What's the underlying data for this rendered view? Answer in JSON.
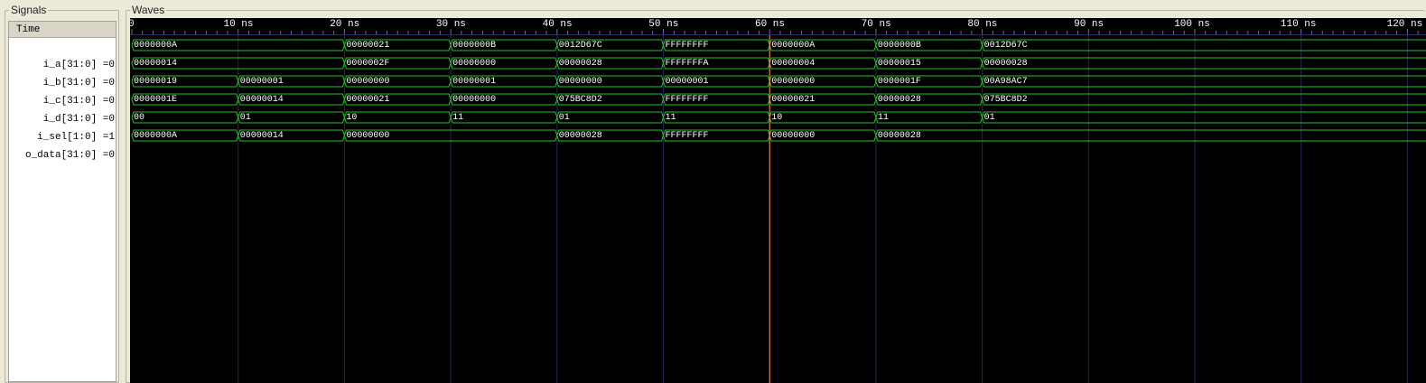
{
  "panels": {
    "signals_title": "Signals",
    "waves_title": "Waves"
  },
  "time_row_label": "Time",
  "signals": [
    {
      "name": "i_a[31:0] =0"
    },
    {
      "name": "i_b[31:0] =0"
    },
    {
      "name": "i_c[31:0] =0"
    },
    {
      "name": "i_d[31:0] =0"
    },
    {
      "name": "i_sel[1:0] =1"
    },
    {
      "name": "o_data[31:0] =0"
    }
  ],
  "timeline": {
    "unit": "ns",
    "major_ticks": [
      0,
      10,
      20,
      30,
      40,
      50,
      60,
      70,
      80,
      90,
      100,
      110,
      120
    ],
    "cursor_time": 60,
    "visible_end": 121
  },
  "waves": [
    {
      "signal": "i_a",
      "segments": [
        {
          "t": 0,
          "v": "0000000A"
        },
        {
          "t": 20,
          "v": "00000021"
        },
        {
          "t": 30,
          "v": "0000000B"
        },
        {
          "t": 40,
          "v": "0012D67C"
        },
        {
          "t": 50,
          "v": "FFFFFFFF"
        },
        {
          "t": 60,
          "v": "0000000A"
        },
        {
          "t": 70,
          "v": "0000000B"
        },
        {
          "t": 80,
          "v": "0012D67C"
        }
      ]
    },
    {
      "signal": "i_b",
      "segments": [
        {
          "t": 0,
          "v": "00000014"
        },
        {
          "t": 20,
          "v": "0000002F"
        },
        {
          "t": 30,
          "v": "00000000"
        },
        {
          "t": 40,
          "v": "00000028"
        },
        {
          "t": 50,
          "v": "FFFFFFFA"
        },
        {
          "t": 60,
          "v": "00000004"
        },
        {
          "t": 70,
          "v": "00000015"
        },
        {
          "t": 80,
          "v": "00000028"
        }
      ]
    },
    {
      "signal": "i_c",
      "segments": [
        {
          "t": 0,
          "v": "00000019"
        },
        {
          "t": 10,
          "v": "00000001"
        },
        {
          "t": 20,
          "v": "00000000"
        },
        {
          "t": 30,
          "v": "00000001"
        },
        {
          "t": 40,
          "v": "00000000"
        },
        {
          "t": 50,
          "v": "00000001"
        },
        {
          "t": 60,
          "v": "00000000"
        },
        {
          "t": 70,
          "v": "0000001F"
        },
        {
          "t": 80,
          "v": "00A98AC7"
        }
      ]
    },
    {
      "signal": "i_d",
      "segments": [
        {
          "t": 0,
          "v": "0000001E"
        },
        {
          "t": 10,
          "v": "00000014"
        },
        {
          "t": 20,
          "v": "00000021"
        },
        {
          "t": 30,
          "v": "00000000"
        },
        {
          "t": 40,
          "v": "075BC8D2"
        },
        {
          "t": 50,
          "v": "FFFFFFFF"
        },
        {
          "t": 60,
          "v": "00000021"
        },
        {
          "t": 70,
          "v": "00000028"
        },
        {
          "t": 80,
          "v": "075BC8D2"
        }
      ]
    },
    {
      "signal": "i_sel",
      "segments": [
        {
          "t": 0,
          "v": "00"
        },
        {
          "t": 10,
          "v": "01"
        },
        {
          "t": 20,
          "v": "10"
        },
        {
          "t": 30,
          "v": "11"
        },
        {
          "t": 40,
          "v": "01"
        },
        {
          "t": 50,
          "v": "11"
        },
        {
          "t": 60,
          "v": "10"
        },
        {
          "t": 70,
          "v": "11"
        },
        {
          "t": 80,
          "v": "01"
        }
      ]
    },
    {
      "signal": "o_data",
      "segments": [
        {
          "t": 0,
          "v": "0000000A"
        },
        {
          "t": 10,
          "v": "00000014"
        },
        {
          "t": 20,
          "v": "00000000"
        },
        {
          "t": 40,
          "v": "00000028"
        },
        {
          "t": 50,
          "v": "FFFFFFFF"
        },
        {
          "t": 60,
          "v": "00000000"
        },
        {
          "t": 70,
          "v": "00000028"
        }
      ]
    }
  ],
  "colors": {
    "wave": "#22c322",
    "grid": "#26265a",
    "cursor": "#ff9a3c",
    "ruler_tick": "#6a6aa8",
    "background": "#000000"
  }
}
